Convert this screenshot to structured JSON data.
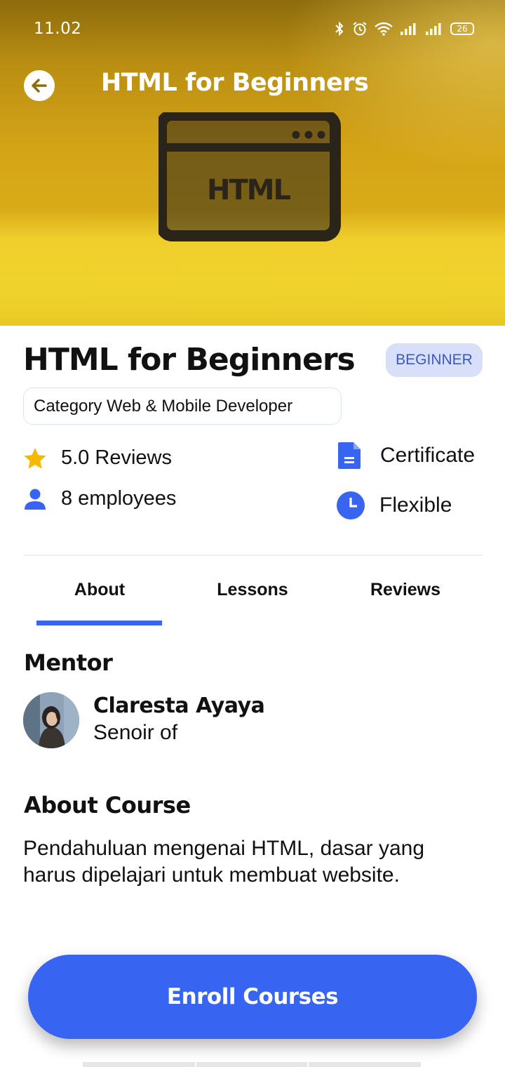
{
  "status_bar": {
    "time": "11.02",
    "battery": "26",
    "icons": [
      "bluetooth-icon",
      "alarm-icon",
      "wifi-icon",
      "signal-icon",
      "signal-icon",
      "battery-icon"
    ]
  },
  "header": {
    "title": "HTML for Beginners",
    "back_icon": "arrow-left-icon"
  },
  "hero_image": {
    "art_text": "HTML",
    "colors": {
      "top": "#8d6b0c",
      "bottom": "#ead02a"
    }
  },
  "course": {
    "title": "HTML for Beginners",
    "level": "BEGINNER",
    "category": "Category Web & Mobile Developer",
    "reviews": "5.0 Reviews",
    "employees": "8 employees",
    "certificate": "Certificate",
    "schedule": "Flexible"
  },
  "tabs": {
    "items": [
      {
        "label": "About"
      },
      {
        "label": "Lessons"
      },
      {
        "label": "Reviews"
      }
    ],
    "active": "About"
  },
  "mentor": {
    "heading": "Mentor",
    "name": "Claresta Ayaya",
    "role": "Senoir of"
  },
  "about_course": {
    "heading": "About Course",
    "text": "Pendahuluan mengenai HTML, dasar yang harus dipelajari untuk membuat website."
  },
  "actions": {
    "enroll_label": "Enroll Courses"
  },
  "colors": {
    "accent": "#3764f0",
    "badge_bg": "#d8dff9",
    "badge_text": "#3d58c6",
    "star": "#f7b900"
  }
}
